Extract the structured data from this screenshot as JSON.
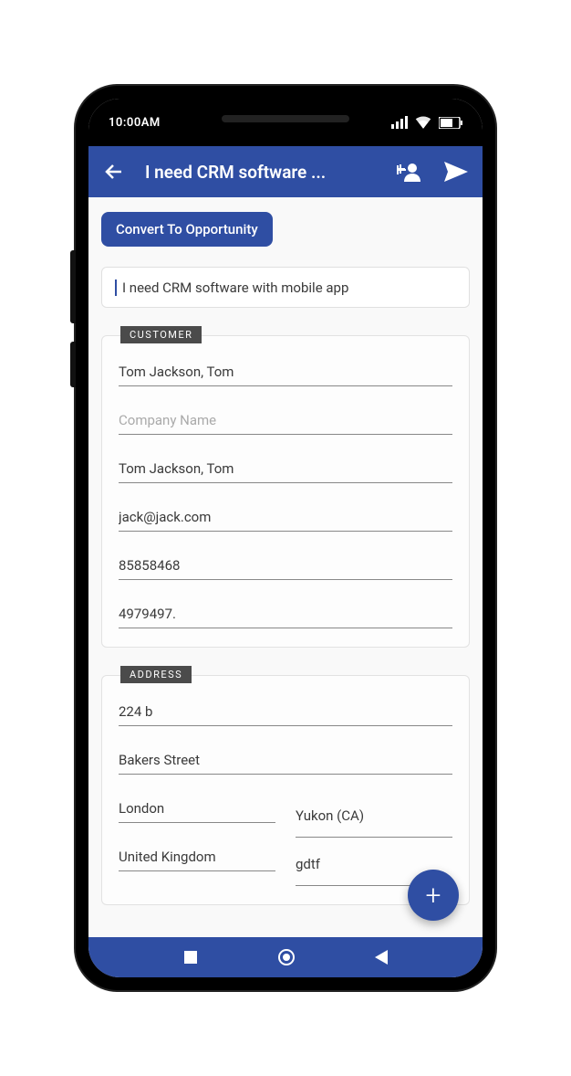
{
  "status": {
    "time": "10:00AM"
  },
  "appbar": {
    "title": "I need CRM software ..."
  },
  "convert_label": "Convert To Opportunity",
  "main_title_value": "I need CRM software with mobile app",
  "customer": {
    "section_label": "CUSTOMER",
    "contact1": "Tom Jackson, Tom",
    "company_placeholder": "Company Name",
    "contact2": "Tom Jackson, Tom",
    "email": "jack@jack.com",
    "phone1": "85858468",
    "phone2": "4979497."
  },
  "address": {
    "section_label": "ADDRESS",
    "line1": "224 b",
    "line2": "Bakers Street",
    "city": "London",
    "state": "Yukon (CA)",
    "country": "United Kingdom",
    "zip": "gdtf"
  },
  "fab_label": "+"
}
